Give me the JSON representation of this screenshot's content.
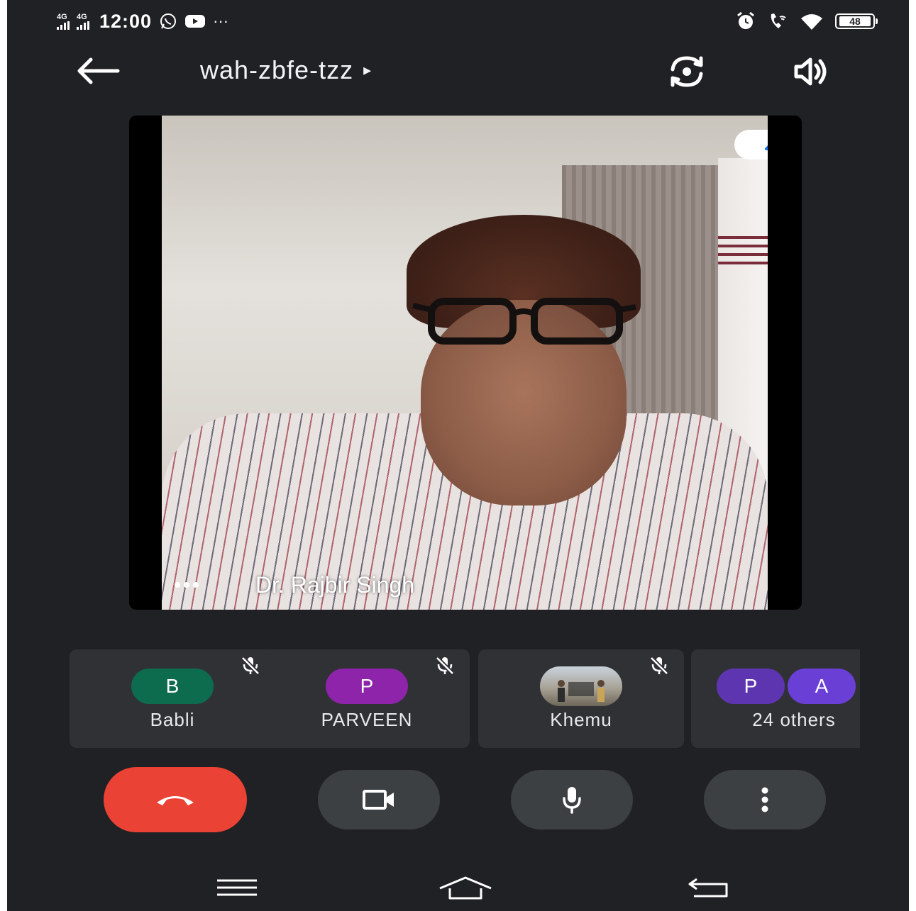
{
  "status_bar": {
    "network_1": "4G",
    "network_2": "4G",
    "time": "12:00",
    "overflow": "···",
    "battery": "48",
    "icons": [
      "signal-icon",
      "whatsapp-icon",
      "youtube-icon",
      "alarm-icon",
      "wifi-call-icon",
      "wifi-icon",
      "battery-icon"
    ]
  },
  "app_bar": {
    "title": "wah-zbfe-tzz",
    "caret": "▸",
    "icons": [
      "back-arrow-icon",
      "switch-camera-icon",
      "speaker-icon"
    ]
  },
  "main_video": {
    "speaker_name": "Dr. Rajbir Singh",
    "icons": [
      "more-dots-icon",
      "pin-icon"
    ]
  },
  "participants": [
    {
      "name": "Babli",
      "initial": "B",
      "avatar_color": "#0d6b4e",
      "muted": true
    },
    {
      "name": "PARVEEN",
      "initial": "P",
      "avatar_color": "#8e24aa",
      "muted": true
    },
    {
      "name": "Khemu",
      "initial": "",
      "avatar_color": "photo",
      "muted": true
    },
    {
      "name": "24 others",
      "initials": [
        "P",
        "A"
      ],
      "avatar_colors": [
        "#5e35b1",
        "#6a3fd6"
      ],
      "muted": false
    }
  ],
  "controls": {
    "icons": [
      "end-call-icon",
      "camera-icon",
      "mic-icon",
      "more-vert-icon"
    ],
    "end_call_color": "#ea4335"
  },
  "nav_bar": {
    "icons": [
      "menu-icon",
      "home-icon",
      "back-icon"
    ]
  },
  "colors": {
    "background": "#202124",
    "tile": "#303134",
    "control": "#3c4043",
    "pin_accent": "#1a73e8"
  }
}
